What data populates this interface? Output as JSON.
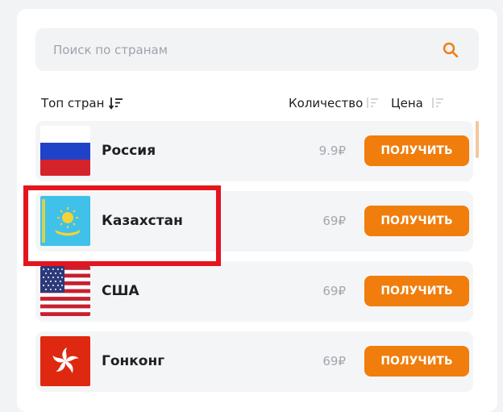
{
  "search": {
    "placeholder": "Поиск по странам"
  },
  "header": {
    "top_label": "Топ стран",
    "quantity_label": "Количество",
    "price_label": "Цена"
  },
  "rows": [
    {
      "country": "Россия",
      "price": "9.9₽",
      "button": "ПОЛУЧИТЬ",
      "flag": "russia-flag"
    },
    {
      "country": "Казахстан",
      "price": "69₽",
      "button": "ПОЛУЧИТЬ",
      "flag": "kazakhstan-flag"
    },
    {
      "country": "США",
      "price": "69₽",
      "button": "ПОЛУЧИТЬ",
      "flag": "usa-flag"
    },
    {
      "country": "Гонконг",
      "price": "69₽",
      "button": "ПОЛУЧИТЬ",
      "flag": "hong-kong-flag"
    }
  ],
  "colors": {
    "accent": "#f07d0c",
    "highlight": "#e4151f",
    "row_bg": "#f4f5f7"
  }
}
